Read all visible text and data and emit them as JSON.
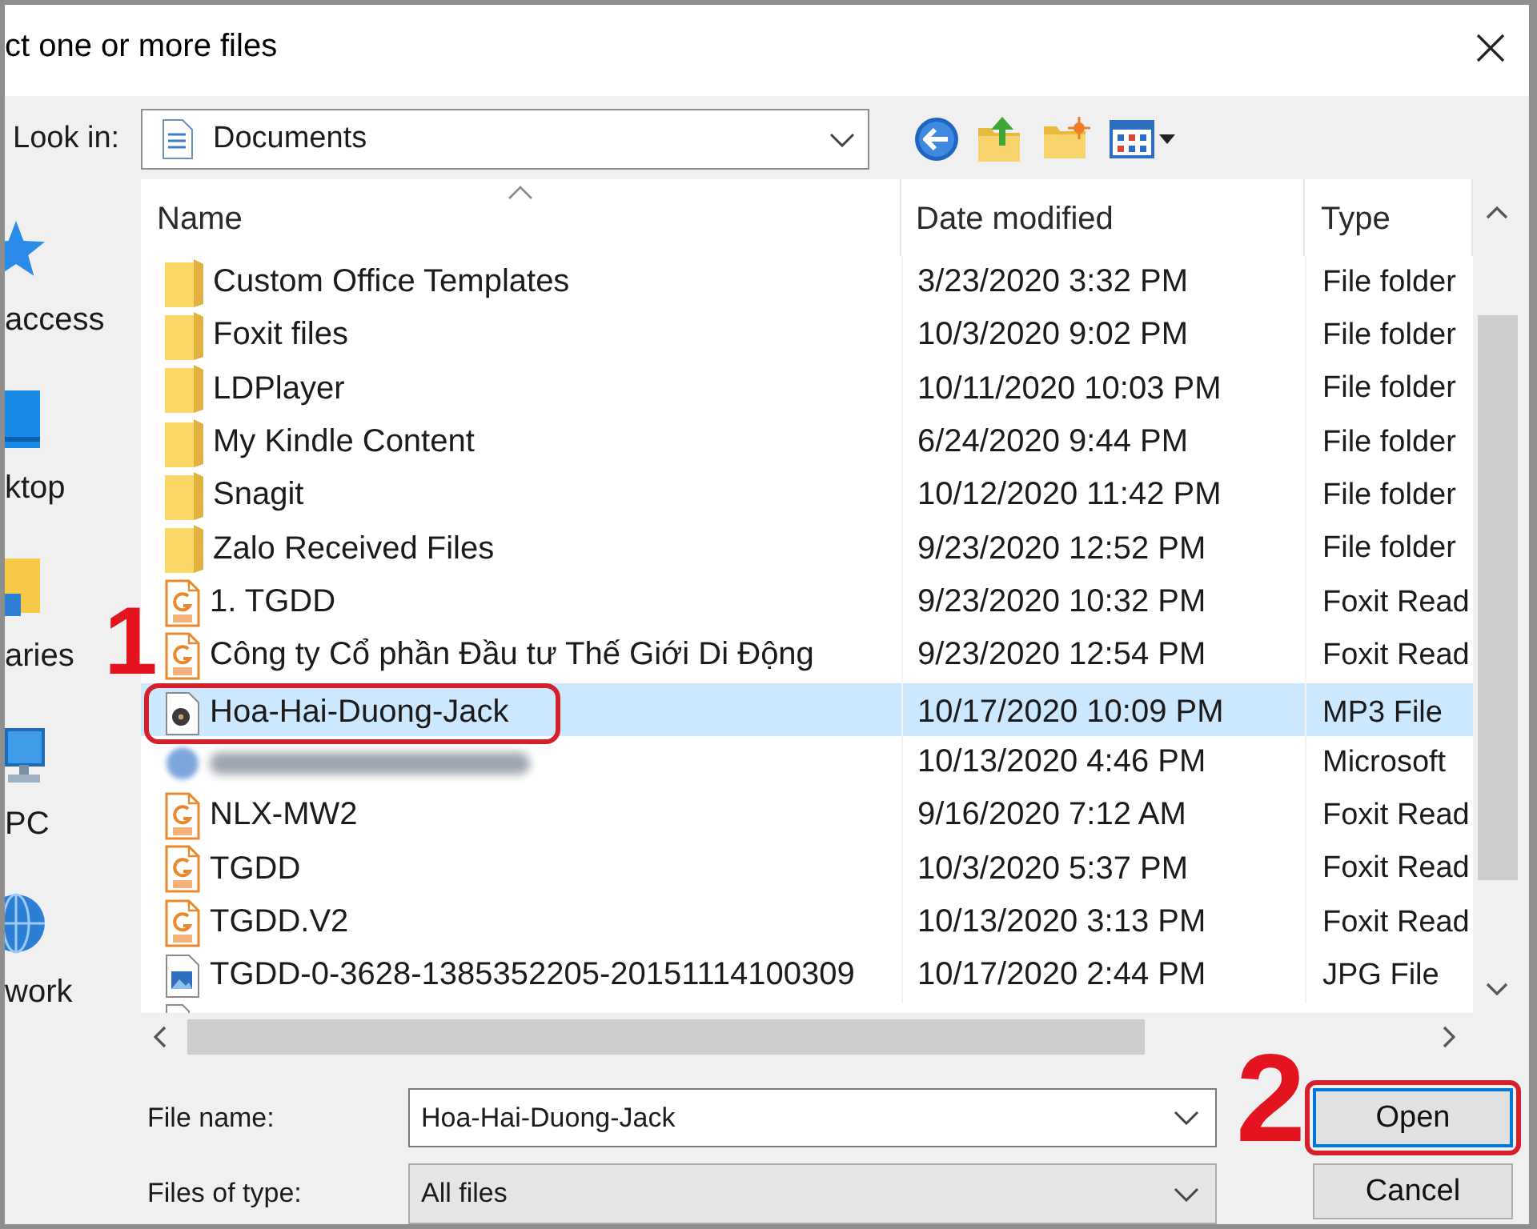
{
  "window": {
    "title": "ct one or more files"
  },
  "look_in": {
    "label": "Look in:",
    "value": "Documents"
  },
  "places": [
    {
      "kind": "star",
      "label": "access"
    },
    {
      "kind": "desktop",
      "label": "ktop"
    },
    {
      "kind": "libraries",
      "label": "aries"
    },
    {
      "kind": "computer",
      "label": "PC"
    },
    {
      "kind": "network",
      "label": "work"
    }
  ],
  "file_list": {
    "columns": [
      {
        "label": "Name",
        "sorted": true
      },
      {
        "label": "Date modified",
        "sorted": false
      },
      {
        "label": "Type",
        "sorted": false
      }
    ],
    "rows": [
      {
        "kind": "folder",
        "name": "Custom Office Templates",
        "date": "3/23/2020 3:32 PM",
        "type": "File folder",
        "selected": false
      },
      {
        "kind": "folder",
        "name": "Foxit files",
        "date": "10/3/2020 9:02 PM",
        "type": "File folder",
        "selected": false
      },
      {
        "kind": "folder",
        "name": "LDPlayer",
        "date": "10/11/2020 10:03 PM",
        "type": "File folder",
        "selected": false
      },
      {
        "kind": "folder",
        "name": "My Kindle Content",
        "date": "6/24/2020 9:44 PM",
        "type": "File folder",
        "selected": false
      },
      {
        "kind": "folder",
        "name": "Snagit",
        "date": "10/12/2020 11:42 PM",
        "type": "File folder",
        "selected": false
      },
      {
        "kind": "folder",
        "name": "Zalo Received Files",
        "date": "9/23/2020 12:52 PM",
        "type": "File folder",
        "selected": false
      },
      {
        "kind": "pdf",
        "name": "1. TGDD",
        "date": "9/23/2020 10:32 PM",
        "type": "Foxit Read",
        "selected": false
      },
      {
        "kind": "pdf",
        "name": "Công ty Cổ phần Đầu tư Thế Giới Di Động",
        "date": "9/23/2020 12:54 PM",
        "type": "Foxit Read",
        "selected": false
      },
      {
        "kind": "audio",
        "name": "Hoa-Hai-Duong-Jack",
        "date": "10/17/2020 10:09 PM",
        "type": "MP3 File",
        "selected": true,
        "callout": "1"
      },
      {
        "kind": "blurred",
        "date": "10/13/2020 4:46 PM",
        "type": "Microsoft",
        "selected": false
      },
      {
        "kind": "pdf",
        "name": "NLX-MW2",
        "date": "9/16/2020 7:12 AM",
        "type": "Foxit Read",
        "selected": false
      },
      {
        "kind": "pdf",
        "name": "TGDD",
        "date": "10/3/2020 5:37 PM",
        "type": "Foxit Read",
        "selected": false
      },
      {
        "kind": "pdf",
        "name": "TGDD.V2",
        "date": "10/13/2020 3:13 PM",
        "type": "Foxit Read",
        "selected": false
      },
      {
        "kind": "image",
        "name": "TGDD-0-3628-1385352205-20151114100309",
        "date": "10/17/2020 2:44 PM",
        "type": "JPG File",
        "selected": false
      },
      {
        "kind": "partial",
        "selected": false
      }
    ]
  },
  "file_name": {
    "label": "File name:",
    "value": "Hoa-Hai-Duong-Jack"
  },
  "file_type": {
    "label": "Files of type:",
    "value": "All files"
  },
  "buttons": [
    {
      "label": "Open",
      "default": true,
      "callout": "2"
    },
    {
      "label": "Cancel",
      "default": false
    }
  ]
}
